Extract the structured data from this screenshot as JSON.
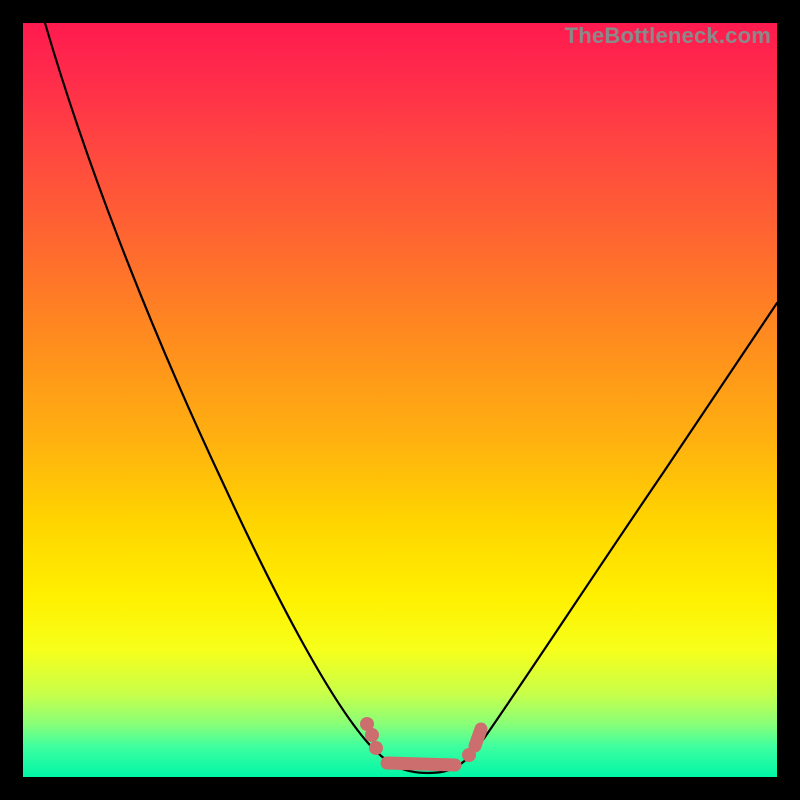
{
  "watermark": "TheBottleneck.com",
  "colors": {
    "frame": "#000000",
    "curve": "#000000",
    "dots": "#cc6e6e"
  },
  "chart_data": {
    "type": "line",
    "title": "",
    "xlabel": "",
    "ylabel": "",
    "xlim": [
      0,
      100
    ],
    "ylim": [
      0,
      100
    ],
    "note": "Axes have no visible tick labels; values are estimated from pixel positions on a 0–100 normalized scale.",
    "series": [
      {
        "name": "bottleneck-curve",
        "x": [
          3,
          10,
          20,
          30,
          40,
          47,
          50,
          53,
          56,
          60,
          70,
          80,
          90,
          100
        ],
        "y": [
          100,
          85,
          66,
          46,
          26,
          8,
          2,
          0,
          0,
          2,
          14,
          29,
          43,
          58
        ]
      }
    ],
    "highlight_region": {
      "name": "optimal-zone-dots",
      "x": [
        47,
        50,
        53,
        56,
        60
      ],
      "y": [
        8,
        2,
        0,
        0,
        2
      ]
    }
  }
}
